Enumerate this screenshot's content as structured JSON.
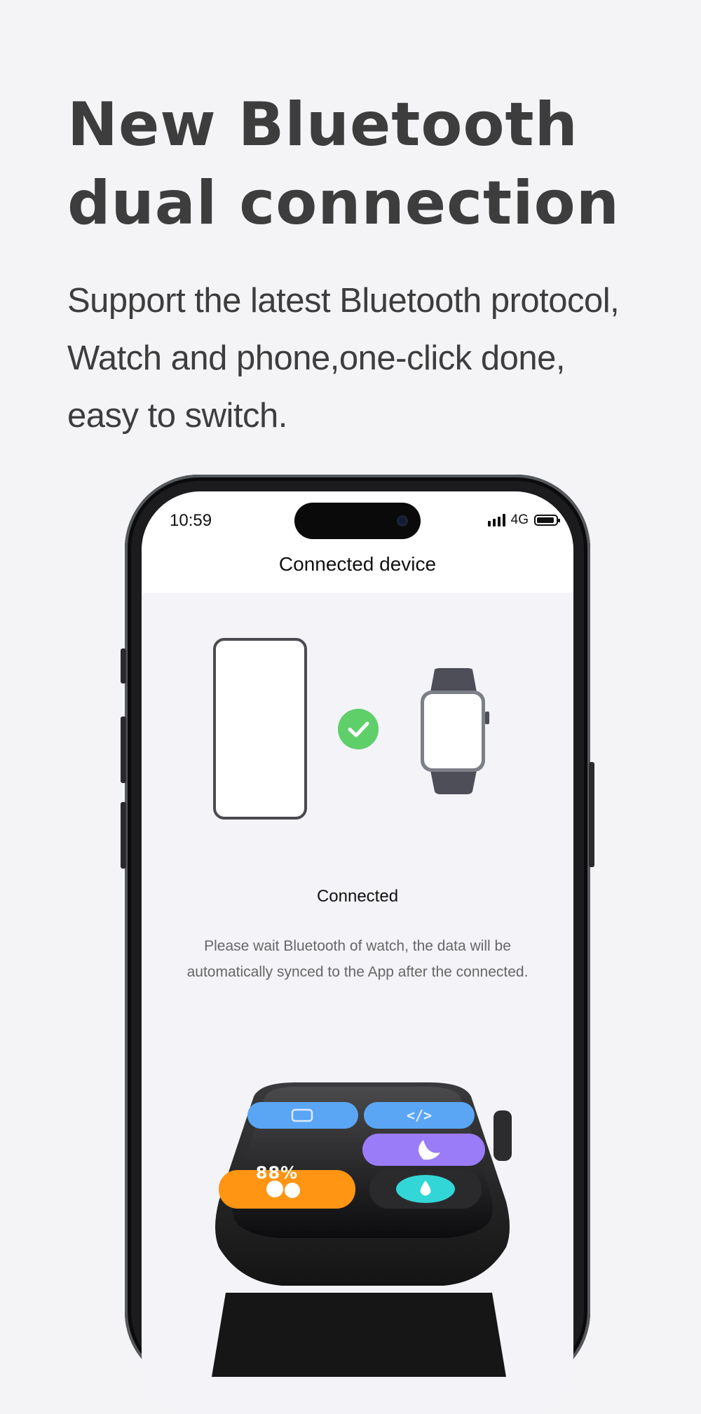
{
  "headline": {
    "line1": "New Bluetooth",
    "line2": "dual connection"
  },
  "subtext": {
    "line1": "Support the latest Bluetooth protocol,",
    "line2": "Watch and phone,one-click done,",
    "line3": "easy to switch."
  },
  "phone_screen": {
    "status_bar": {
      "time": "10:59",
      "network": "4G",
      "icons": [
        "signal-icon",
        "battery-icon"
      ]
    },
    "title": "Connected device",
    "status_label": "Connected",
    "description": {
      "line1": "Please wait Bluetooth of watch, the data will be",
      "line2": "automatically synced to the App after the connected."
    }
  },
  "watch_display": {
    "battery_percent": "88%",
    "tiles": [
      "phone-icon",
      "code-icon",
      "moon-icon",
      "theater-masks-icon",
      "water-drop-icon"
    ]
  },
  "colors": {
    "background": "#f4f4f6",
    "check_green": "#5fcf6a",
    "tile_blue": "#5aa6f5",
    "tile_purple": "#9a7cf8",
    "tile_orange": "#ff9512",
    "tile_teal": "#33d6d6"
  }
}
